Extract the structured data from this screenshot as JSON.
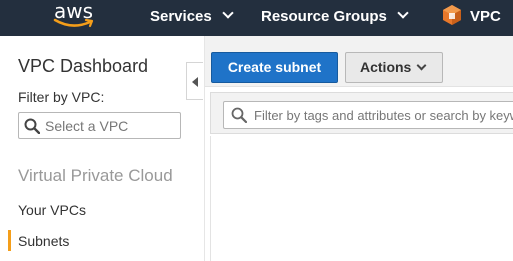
{
  "nav": {
    "logo_text": "aws",
    "services_label": "Services",
    "resource_groups_label": "Resource Groups",
    "vpc_label": "VPC"
  },
  "sidebar": {
    "title": "VPC Dashboard",
    "filter_label": "Filter by VPC:",
    "select_placeholder": "Select a VPC",
    "section_title": "Virtual Private Cloud",
    "items": [
      {
        "label": "Your VPCs",
        "active": false
      },
      {
        "label": "Subnets",
        "active": true
      }
    ]
  },
  "toolbar": {
    "create_label": "Create subnet",
    "actions_label": "Actions"
  },
  "filter": {
    "placeholder": "Filter by tags and attributes or search by keyword"
  },
  "colors": {
    "nav_bg": "#232f3e",
    "primary_button": "#1f73c8",
    "active_indicator": "#f49e1a",
    "vpc_icon": "#e8782a"
  },
  "icons": {
    "logo": "aws-smile-logo",
    "services_caret": "chevron-down-icon",
    "vpc": "vpc-cube-icon",
    "select_search": "search-icon",
    "collapse": "collapse-left-icon",
    "actions_caret": "chevron-down-icon",
    "filter_search": "search-icon"
  }
}
